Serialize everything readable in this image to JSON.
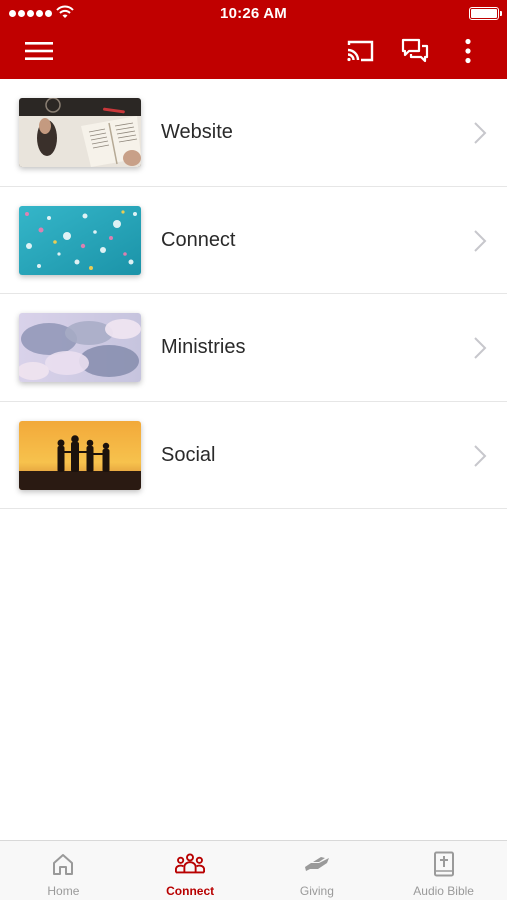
{
  "status_bar": {
    "time": "10:26 AM"
  },
  "app_bar": {
    "icons": {
      "menu": "hamburger-menu-icon",
      "cast": "cast-icon",
      "chat": "chat-bubbles-icon",
      "more": "more-vertical-icon"
    }
  },
  "colors": {
    "brand": "#c00000",
    "active_tab": "#b80000",
    "inactive_tab": "#9a9a9a"
  },
  "list": {
    "items": [
      {
        "label": "Website",
        "thumbnail": "open-bible-photo"
      },
      {
        "label": "Connect",
        "thumbnail": "confetti-on-teal-photo"
      },
      {
        "label": "Ministries",
        "thumbnail": "clouds-sky-photo"
      },
      {
        "label": "Social",
        "thumbnail": "sunset-silhouettes-photo"
      }
    ]
  },
  "tabs": [
    {
      "label": "Home",
      "icon": "home-icon",
      "active": false
    },
    {
      "label": "Connect",
      "icon": "people-group-icon",
      "active": true
    },
    {
      "label": "Giving",
      "icon": "giving-hand-icon",
      "active": false
    },
    {
      "label": "Audio Bible",
      "icon": "bible-book-icon",
      "active": false
    }
  ]
}
